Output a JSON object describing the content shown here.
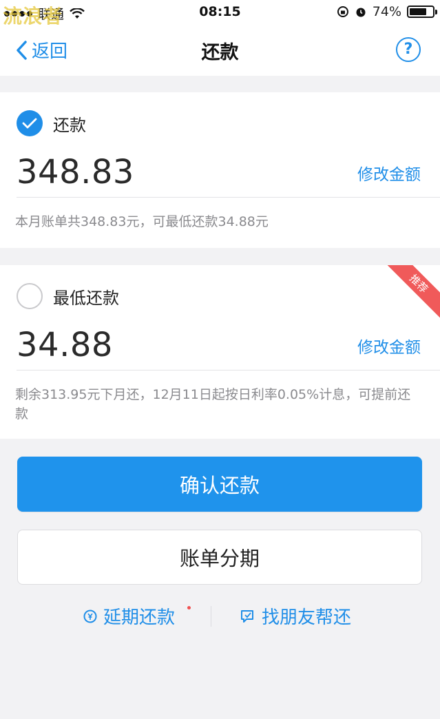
{
  "status_bar": {
    "carrier": "联通",
    "time": "08:15",
    "battery": "74%",
    "battery_level": 0.74
  },
  "watermark": "流浪者",
  "nav": {
    "back_label": "返回",
    "title": "还款",
    "help_label": "?"
  },
  "options": [
    {
      "label": "还款",
      "selected": true,
      "amount": "348.83",
      "edit_label": "修改金额",
      "note": "本月账单共348.83元，可最低还款34.88元"
    },
    {
      "label": "最低还款",
      "selected": false,
      "amount": "34.88",
      "edit_label": "修改金额",
      "note": "剩余313.95元下月还，12月11日起按日利率0.05%计息，可提前还款",
      "ribbon": "推荐"
    }
  ],
  "buttons": {
    "confirm": "确认还款",
    "installment": "账单分期"
  },
  "links": {
    "defer": "延期还款",
    "friend": "找朋友帮还"
  },
  "colors": {
    "accent": "#1f8ee8",
    "primary_button": "#1f93ec",
    "ribbon": "#f05a5a"
  },
  "icons": {
    "back": "chevron-left-icon",
    "help": "question-circle-icon",
    "check": "check-icon",
    "defer": "clock-yen-icon",
    "friend": "chat-bubble-icon"
  }
}
